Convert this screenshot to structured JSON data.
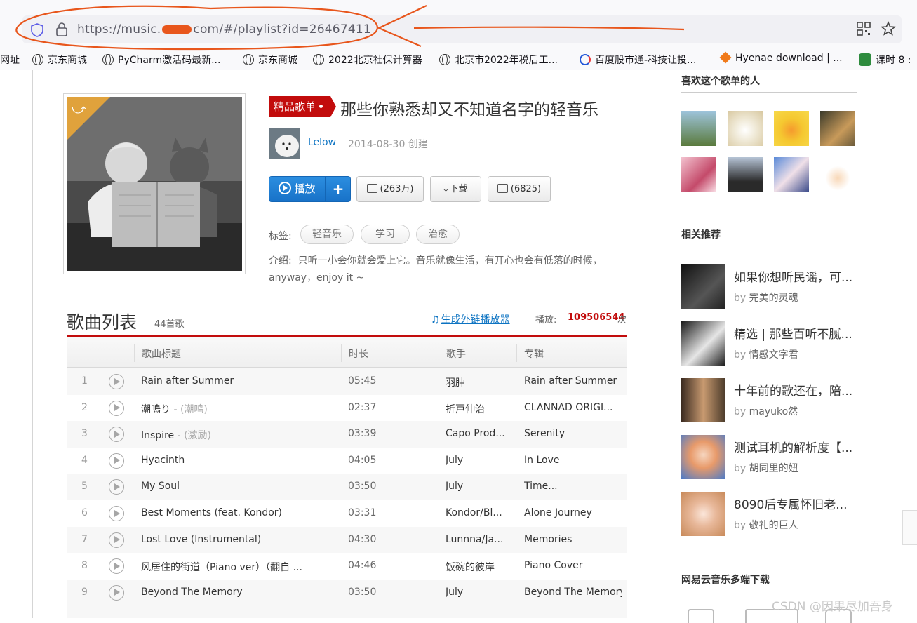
{
  "browser": {
    "url_prefix": "https://music.",
    "url_suffix": "com/#/playlist?id=26467411",
    "icons": [
      "shield-icon",
      "lock-icon",
      "qr-code-icon",
      "star-icon"
    ]
  },
  "bookmarks": [
    "网址",
    "京东商城",
    "PyCharm激活码最新...",
    "京东商城",
    "2022北京社保计算器",
    "北京市2022年税后工...",
    "百度股市通-科技让投...",
    "Hyenae download | ...",
    "课时 8 :"
  ],
  "playlist": {
    "tag": "精品歌单",
    "title": "那些你熟悉却又不知道名字的轻音乐",
    "author": "Lelow",
    "created": "2014-08-30 创建",
    "buttons": {
      "play": "播放",
      "add": "+",
      "fav": "(263万)",
      "download": "下载",
      "comments": "(6825)"
    },
    "labels_title": "标签:",
    "labels": [
      "轻音乐",
      "学习",
      "治愈"
    ],
    "intro_label": "介绍:",
    "intro": "只听一小会你就会爱上它。音乐就像生活，有开心也会有低落的时候，anyway，enjoy it ~"
  },
  "songlist": {
    "title": "歌曲列表",
    "count": "44首歌",
    "outlink": "生成外链播放器",
    "plays_label": "播放:",
    "plays": "109506544",
    "plays_unit": "次",
    "headers": [
      "歌曲标题",
      "时长",
      "歌手",
      "专辑"
    ],
    "rows": [
      {
        "idx": "1",
        "title": "Rain after Summer",
        "alias": "",
        "time": "05:45",
        "artist": "羽肿",
        "album": "Rain after Summer"
      },
      {
        "idx": "2",
        "title": "潮鳴り",
        "alias": " - (潮鸣)",
        "time": "02:37",
        "artist": "折戸伸治",
        "album": "CLANNAD ORIGI..."
      },
      {
        "idx": "3",
        "title": "Inspire",
        "alias": " - (激励)",
        "time": "03:39",
        "artist": "Capo Prod...",
        "album": "Serenity"
      },
      {
        "idx": "4",
        "title": "Hyacinth",
        "alias": "",
        "time": "04:05",
        "artist": "July",
        "album": "In Love"
      },
      {
        "idx": "5",
        "title": "My Soul",
        "alias": "",
        "time": "03:50",
        "artist": "July",
        "album": "Time..."
      },
      {
        "idx": "6",
        "title": "Best Moments (feat. Kondor)",
        "alias": "",
        "time": "03:31",
        "artist": "Kondor/Bl...",
        "album": "Alone Journey"
      },
      {
        "idx": "7",
        "title": "Lost Love (Instrumental)",
        "alias": "",
        "time": "04:30",
        "artist": "Lunnna/Ja...",
        "album": "Memories"
      },
      {
        "idx": "8",
        "title": "风居住的街道（Piano ver）（翻自 ...",
        "alias": "",
        "time": "04:46",
        "artist": "饭碗的彼岸",
        "album": "Piano Cover"
      },
      {
        "idx": "9",
        "title": "Beyond The Memory",
        "alias": "",
        "time": "03:50",
        "artist": "July",
        "album": "Beyond The Memory"
      }
    ]
  },
  "sidebar": {
    "fans_title": "喜欢这个歌单的人",
    "related_title": "相关推荐",
    "related": [
      {
        "title": "如果你想听民谣，可...",
        "by": "by",
        "user": "完美的灵魂"
      },
      {
        "title": "精选 | 那些百听不腻...",
        "by": "by",
        "user": "情感文字君"
      },
      {
        "title": "十年前的歌还在，陪...",
        "by": "by",
        "user": "mayuko然"
      },
      {
        "title": "测试耳机的解析度【...",
        "by": "by",
        "user": "胡同里的妞"
      },
      {
        "title": "8090后专属怀旧老...",
        "by": "by",
        "user": "敬礼的巨人"
      }
    ],
    "download_title": "网易云音乐多端下载"
  },
  "watermark": "CSDN @因果尽加吾身",
  "colors": {
    "accent": "#c20c0c",
    "link": "#0c73c2",
    "play_button": "#1872c8",
    "annotation": "#e8561c"
  }
}
